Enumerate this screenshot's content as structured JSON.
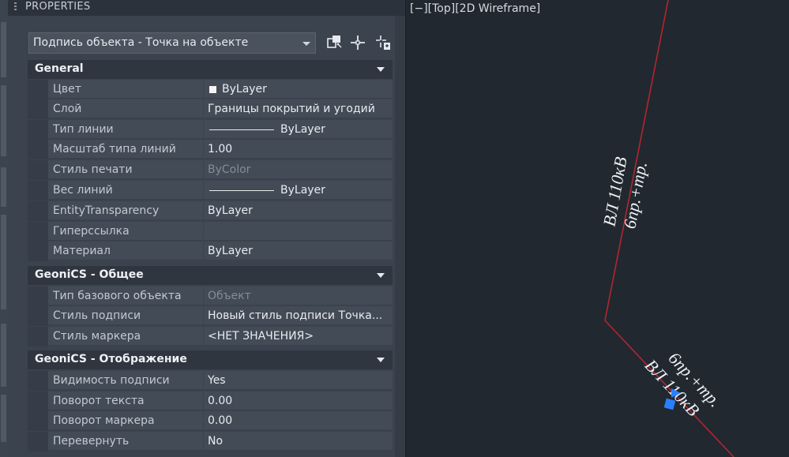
{
  "palette": {
    "title": "PROPERTIES",
    "selector_value": "Подпись объекта - Точка на объекте",
    "toolbar_icons": [
      "quick-select-icon",
      "select-objects-icon",
      "toggle-pickadd-icon"
    ]
  },
  "sections": {
    "general": {
      "title": "General",
      "rows": [
        {
          "name": "Цвет",
          "value": "ByLayer",
          "swatch": "#f4f4f4"
        },
        {
          "name": "Слой",
          "value": "Границы покрытий и угодий"
        },
        {
          "name": "Тип линии",
          "value": "ByLayer"
        },
        {
          "name": "Масштаб типа линий",
          "value": "1.00"
        },
        {
          "name": "Стиль печати",
          "value": "ByColor"
        },
        {
          "name": "Вес линий",
          "value": "ByLayer"
        },
        {
          "name": "EntityTransparency",
          "value": "ByLayer"
        },
        {
          "name": "Гиперссылка",
          "value": ""
        },
        {
          "name": "Материал",
          "value": "ByLayer"
        }
      ]
    },
    "geonics_common": {
      "title": "GeoniCS - Общее",
      "rows": [
        {
          "name": "Тип базового объекта",
          "value": "Объект"
        },
        {
          "name": "Стиль подписи",
          "value": "Новый стиль подписи Точка..."
        },
        {
          "name": "Стиль маркера",
          "value": "<НЕТ ЗНАЧЕНИЯ>"
        }
      ]
    },
    "geonics_display": {
      "title": "GeoniCS - Отображение",
      "rows": [
        {
          "name": "Видимость подписи",
          "value": "Yes"
        },
        {
          "name": "Поворот текста",
          "value": "0.00"
        },
        {
          "name": "Поворот маркера",
          "value": "0.00"
        },
        {
          "name": "Перевернуть",
          "value": "No"
        }
      ]
    }
  },
  "viewport": {
    "label": "[−][Top][2D Wireframe]",
    "annotations": {
      "upper_line1": "ВЛ 110кВ",
      "upper_line2": "6пр.+тр.",
      "lower_line1": "6пр.+тр.",
      "lower_line2": "ВЛ 110кВ"
    },
    "colors": {
      "background": "#212830",
      "polyline": "#b3262e",
      "grip": "#2a7fff",
      "text": "#eef1f4"
    }
  }
}
